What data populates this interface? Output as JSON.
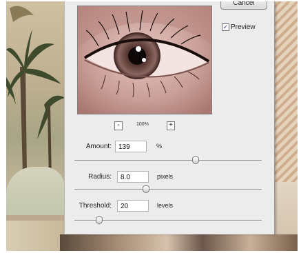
{
  "dialog": {
    "cancel_label": "Cancel",
    "preview": {
      "label": "Preview",
      "checked": true,
      "check_glyph": "✓"
    },
    "zoom": {
      "minus_label": "-",
      "value": "100%",
      "plus_label": "+"
    },
    "amount": {
      "label": "Amount:",
      "value": "139",
      "unit": "%",
      "slider_fraction": 0.6
    },
    "radius": {
      "label": "Radius:",
      "value": "8.0",
      "unit": "pixels",
      "slider_fraction": 0.3
    },
    "threshold": {
      "label": "Threshold:",
      "value": "20",
      "unit": "levels",
      "slider_fraction": 0.08
    }
  },
  "icons": {
    "checkbox": "checkmark-icon",
    "zoom_out": "minus-icon",
    "zoom_in": "plus-icon"
  },
  "colors": {
    "dialog_bg": "#ececec",
    "checkmark": "#2a3f8f"
  }
}
